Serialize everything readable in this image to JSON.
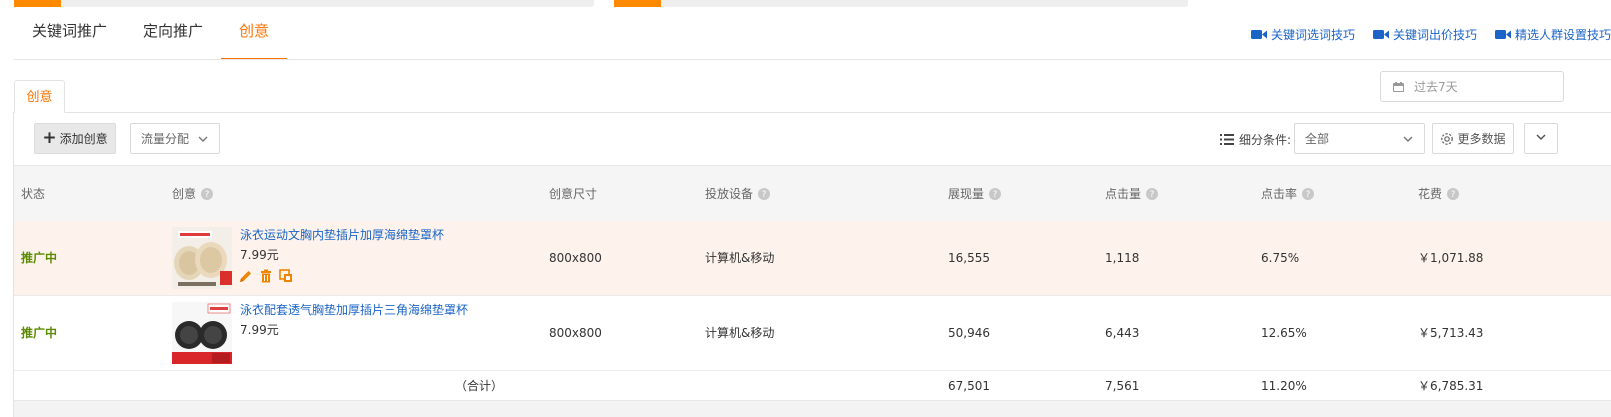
{
  "main_tabs": [
    {
      "label": "关键词推广",
      "active": false
    },
    {
      "label": "定向推广",
      "active": false
    },
    {
      "label": "创意",
      "active": true
    }
  ],
  "tips": [
    {
      "label": "关键词选词技巧",
      "icon": "video-camera-icon"
    },
    {
      "label": "关键词出价技巧",
      "icon": "video-camera-icon"
    },
    {
      "label": "精选人群设置技巧",
      "icon": "video-camera-icon"
    }
  ],
  "date_picker": {
    "placeholder": "过去7天",
    "icon": "calendar-icon"
  },
  "sub_tab": {
    "label": "创意"
  },
  "toolbar": {
    "add_label": "添加创意",
    "flow_label": "流量分配",
    "filter_label": "细分条件:",
    "filter_value": "全部",
    "more_label": "更多数据"
  },
  "table": {
    "headers": {
      "status": "状态",
      "creative": "创意",
      "size": "创意尺寸",
      "device": "投放设备",
      "impressions": "展现量",
      "clicks": "点击量",
      "ctr": "点击率",
      "cost": "花费"
    },
    "rows": [
      {
        "status": "推广中",
        "title": "泳衣运动文胸内垫插片加厚海绵垫罩杯",
        "price": "7.99元",
        "size": "800x800",
        "device": "计算机&移动",
        "impressions": "16,555",
        "clicks": "1,118",
        "ctr": "6.75%",
        "cost": "￥1,071.88"
      },
      {
        "status": "推广中",
        "title": "泳衣配套透气胸垫加厚插片三角海绵垫罩杯",
        "price": "7.99元",
        "size": "800x800",
        "device": "计算机&移动",
        "impressions": "50,946",
        "clicks": "6,443",
        "ctr": "12.65%",
        "cost": "￥5,713.43"
      }
    ],
    "summary": {
      "label": "（合计）",
      "impressions": "67,501",
      "clicks": "7,561",
      "ctr": "11.20%",
      "cost": "￥6,785.31"
    }
  },
  "colors": {
    "accent": "#ff7300",
    "link": "#1a64c8",
    "status_active": "#5c8a00",
    "row_highlight": "#fdf3ec"
  }
}
